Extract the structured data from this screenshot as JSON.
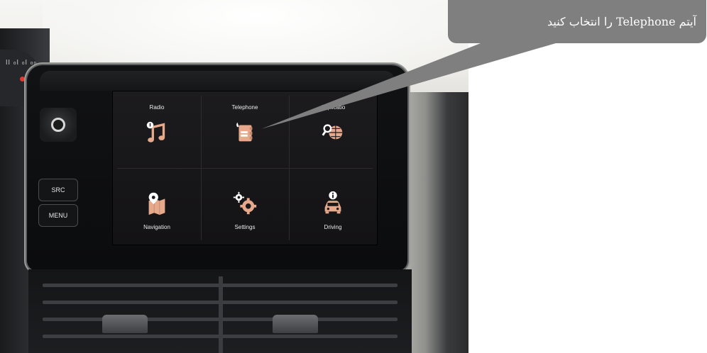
{
  "callout": {
    "text": "آیتم Telephone را انتخاب کنید"
  },
  "head_unit": {
    "hardware_buttons": {
      "src_label": "SRC",
      "menu_label": "MENU"
    },
    "cluster_marks": "ll ₀l ₀l ₀₀"
  },
  "screen": {
    "tiles": [
      {
        "label": "Radio",
        "icon": "music-note-icon"
      },
      {
        "label": "Telephone",
        "icon": "phone-book-icon"
      },
      {
        "label": "Applicatio",
        "icon": "globe-search-icon"
      },
      {
        "label": "Navigation",
        "icon": "map-pin-icon"
      },
      {
        "label": "Settings",
        "icon": "gears-icon"
      },
      {
        "label": "Driving",
        "icon": "car-info-icon"
      }
    ]
  },
  "colors": {
    "icon_accent": "#e6a98c",
    "callout_bg": "#7f7f7f",
    "screen_bg": "#1a191b"
  }
}
